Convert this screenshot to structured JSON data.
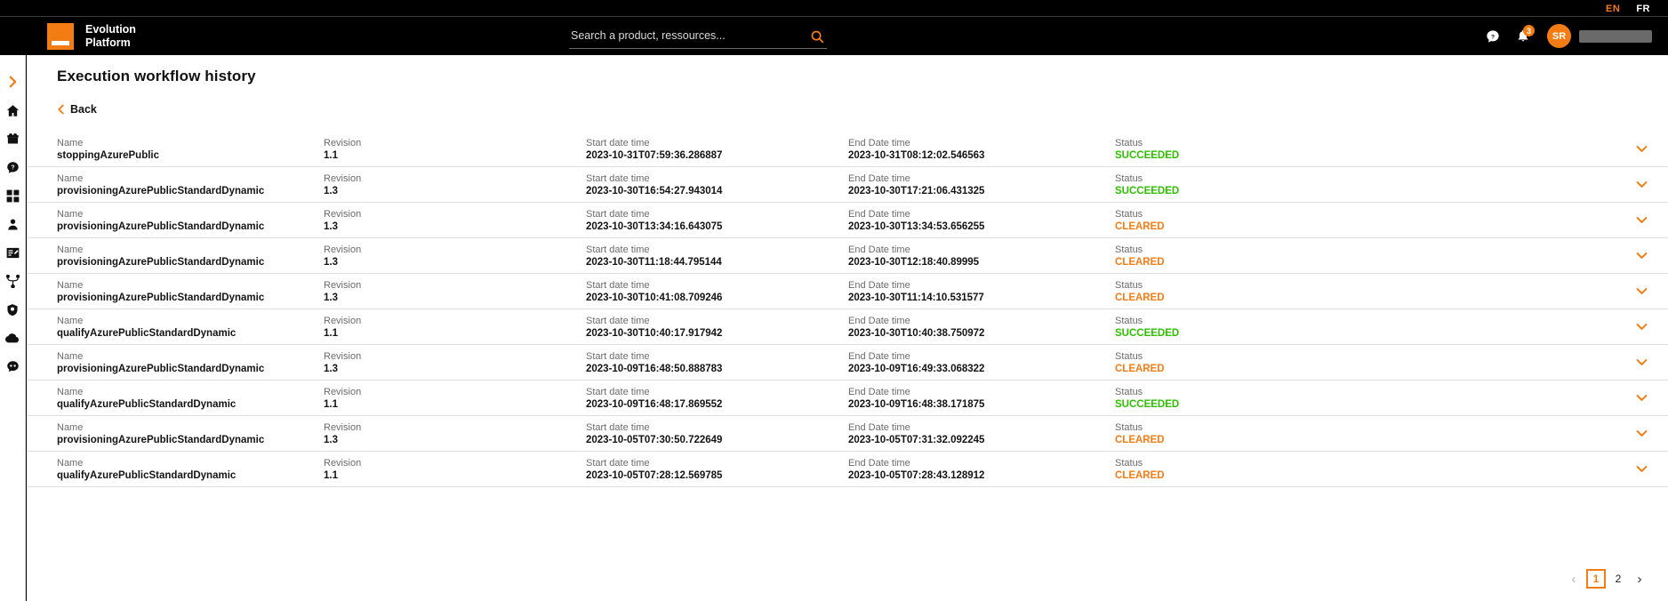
{
  "topbar": {
    "languages": [
      {
        "code": "EN",
        "active": true
      },
      {
        "code": "FR",
        "active": false
      }
    ]
  },
  "header": {
    "brand_line1": "Evolution",
    "brand_line2": "Platform",
    "logo_icon": "orange-square-logo",
    "search": {
      "placeholder": "Search a product, ressources...",
      "value": "",
      "icon": "search-icon"
    },
    "help_icon": "help-circle-icon",
    "notifications": {
      "icon": "bell-icon",
      "count": "3"
    },
    "avatar_initials": "SR",
    "user_name": ""
  },
  "sidebar": {
    "items": [
      {
        "icon": "chevron-right-icon",
        "name": "expand-menu"
      },
      {
        "icon": "home-icon",
        "name": "home"
      },
      {
        "icon": "products-icon",
        "name": "products"
      },
      {
        "icon": "help-bubble-icon",
        "name": "support"
      },
      {
        "icon": "grid-icon",
        "name": "dashboard"
      },
      {
        "icon": "user-icon",
        "name": "account"
      },
      {
        "icon": "form-edit-icon",
        "name": "orders"
      },
      {
        "icon": "network-icon",
        "name": "network"
      },
      {
        "icon": "shield-icon",
        "name": "security"
      },
      {
        "icon": "cloud-icon",
        "name": "cloud"
      },
      {
        "icon": "chat-icon",
        "name": "chat"
      }
    ]
  },
  "main": {
    "title": "Execution workflow history",
    "back_label": "Back",
    "back_icon": "chevron-left-icon",
    "labels": {
      "name": "Name",
      "revision": "Revision",
      "start": "Start date time",
      "end": "End Date time",
      "status": "Status"
    },
    "row_toggle_icon": "chevron-down-icon",
    "status_colors": {
      "SUCCEEDED": "#2ec000",
      "CLEARED": "#f57c12"
    },
    "rows": [
      {
        "name": "stoppingAzurePublic",
        "revision": "1.1",
        "start": "2023-10-31T07:59:36.286887",
        "end": "2023-10-31T08:12:02.546563",
        "status": "SUCCEEDED"
      },
      {
        "name": "provisioningAzurePublicStandardDynamic",
        "revision": "1.3",
        "start": "2023-10-30T16:54:27.943014",
        "end": "2023-10-30T17:21:06.431325",
        "status": "SUCCEEDED"
      },
      {
        "name": "provisioningAzurePublicStandardDynamic",
        "revision": "1.3",
        "start": "2023-10-30T13:34:16.643075",
        "end": "2023-10-30T13:34:53.656255",
        "status": "CLEARED"
      },
      {
        "name": "provisioningAzurePublicStandardDynamic",
        "revision": "1.3",
        "start": "2023-10-30T11:18:44.795144",
        "end": "2023-10-30T12:18:40.89995",
        "status": "CLEARED"
      },
      {
        "name": "provisioningAzurePublicStandardDynamic",
        "revision": "1.3",
        "start": "2023-10-30T10:41:08.709246",
        "end": "2023-10-30T11:14:10.531577",
        "status": "CLEARED"
      },
      {
        "name": "qualifyAzurePublicStandardDynamic",
        "revision": "1.1",
        "start": "2023-10-30T10:40:17.917942",
        "end": "2023-10-30T10:40:38.750972",
        "status": "SUCCEEDED"
      },
      {
        "name": "provisioningAzurePublicStandardDynamic",
        "revision": "1.3",
        "start": "2023-10-09T16:48:50.888783",
        "end": "2023-10-09T16:49:33.068322",
        "status": "CLEARED"
      },
      {
        "name": "qualifyAzurePublicStandardDynamic",
        "revision": "1.1",
        "start": "2023-10-09T16:48:17.869552",
        "end": "2023-10-09T16:48:38.171875",
        "status": "SUCCEEDED"
      },
      {
        "name": "provisioningAzurePublicStandardDynamic",
        "revision": "1.3",
        "start": "2023-10-05T07:30:50.722649",
        "end": "2023-10-05T07:31:32.092245",
        "status": "CLEARED"
      },
      {
        "name": "qualifyAzurePublicStandardDynamic",
        "revision": "1.1",
        "start": "2023-10-05T07:28:12.569785",
        "end": "2023-10-05T07:28:43.128912",
        "status": "CLEARED"
      }
    ],
    "pagination": {
      "prev": "‹",
      "next": "›",
      "pages": [
        {
          "label": "1",
          "current": true
        },
        {
          "label": "2",
          "current": false
        }
      ]
    }
  }
}
